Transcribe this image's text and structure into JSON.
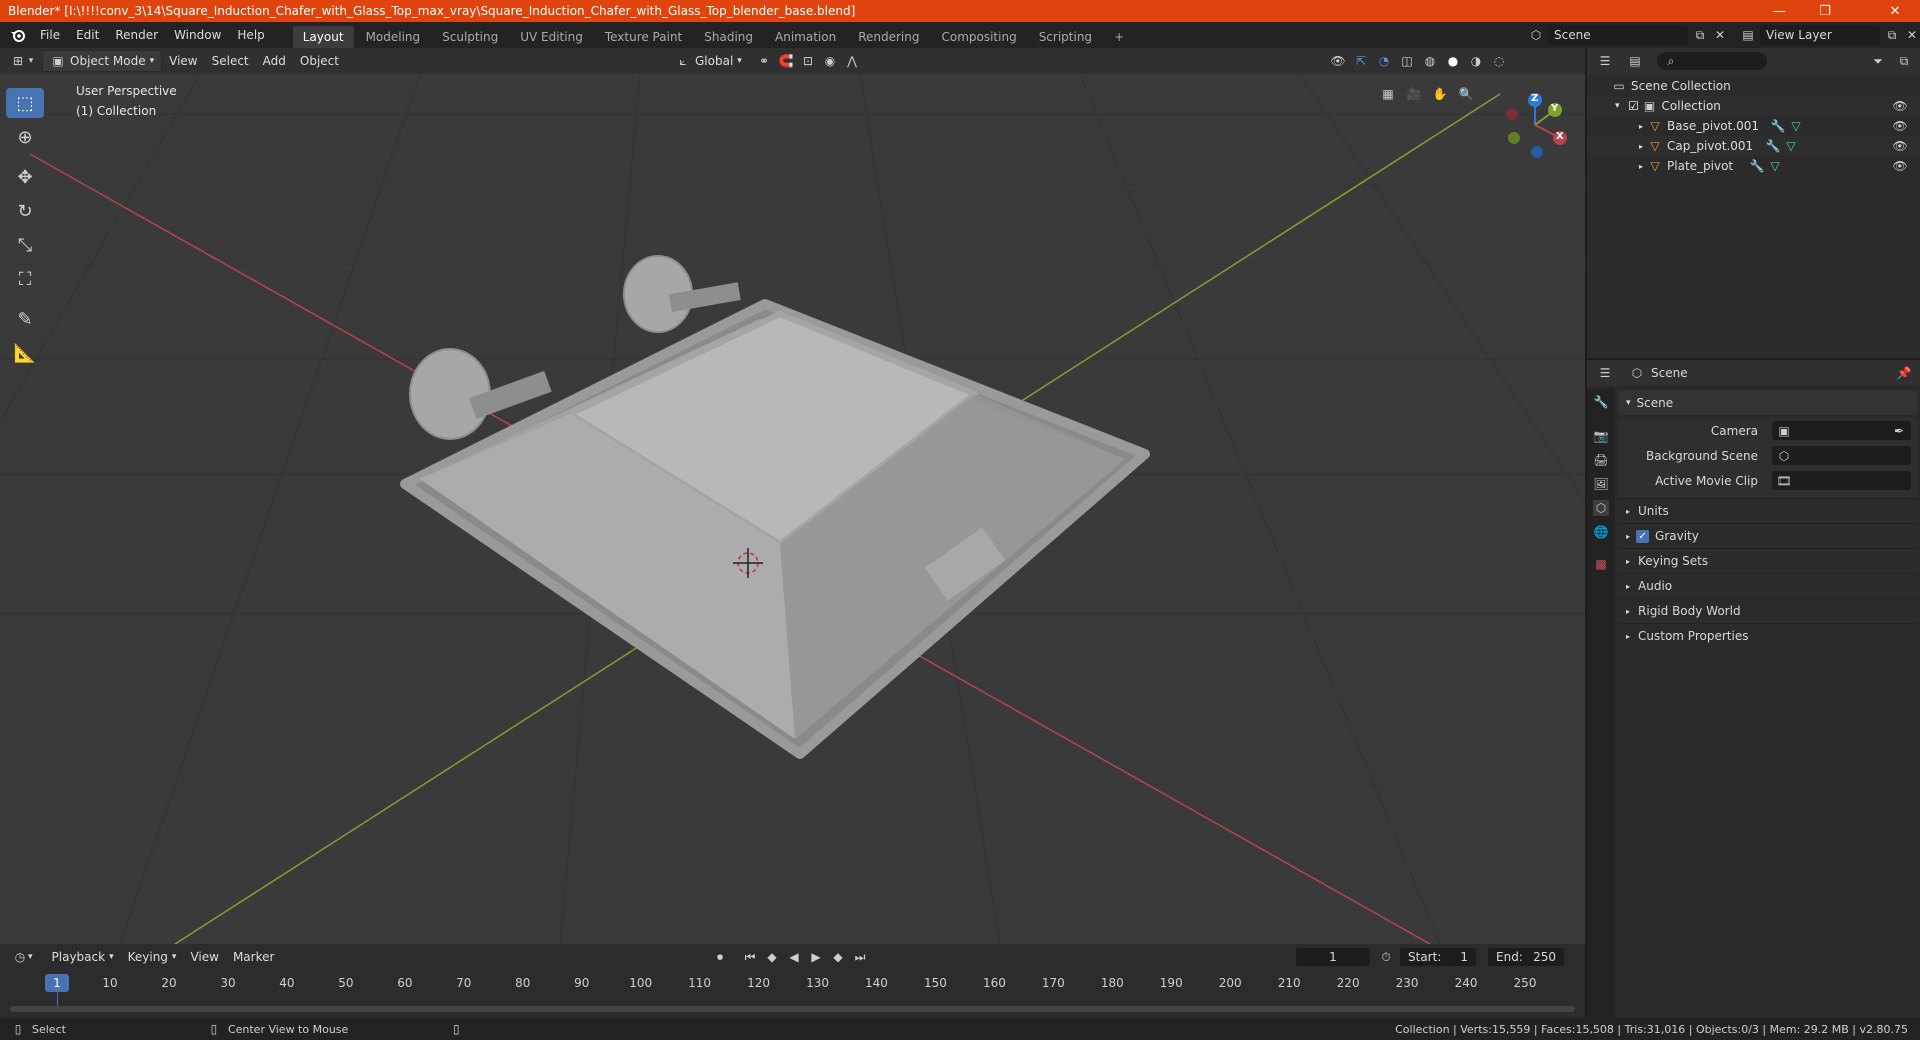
{
  "window": {
    "title": "Blender* [I:\\!!!!conv_3\\14\\Square_Induction_Chafer_with_Glass_Top_max_vray\\Square_Induction_Chafer_with_Glass_Top_blender_base.blend]",
    "minimize": "—",
    "restore": "❐",
    "close": "✕"
  },
  "menu": [
    "File",
    "Edit",
    "Render",
    "Window",
    "Help"
  ],
  "workspaces": [
    "Layout",
    "Modeling",
    "Sculpting",
    "UV Editing",
    "Texture Paint",
    "Shading",
    "Animation",
    "Rendering",
    "Compositing",
    "Scripting"
  ],
  "workspace_add": "+",
  "scene_selector": {
    "scene": "Scene",
    "view_layer": "View Layer"
  },
  "viewport_header": {
    "mode": "Object Mode",
    "menus": [
      "View",
      "Select",
      "Add",
      "Object"
    ],
    "orientation": "Global"
  },
  "viewport": {
    "overlay_line1": "User Perspective",
    "overlay_line2": "(1) Collection",
    "gizmo": {
      "z": "Z",
      "y": "Y",
      "x": "X"
    }
  },
  "outliner": {
    "root": "Scene Collection",
    "collection": "Collection",
    "objects": [
      "Base_pivot.001",
      "Cap_pivot.001",
      "Plate_pivot"
    ]
  },
  "properties": {
    "context": "Scene",
    "section": "Scene",
    "fields": [
      {
        "label": "Camera"
      },
      {
        "label": "Background Scene"
      },
      {
        "label": "Active Movie Clip"
      }
    ],
    "panels": [
      "Units",
      "Gravity",
      "Keying Sets",
      "Audio",
      "Rigid Body World",
      "Custom Properties"
    ]
  },
  "timeline": {
    "menus": [
      "Playback",
      "Keying",
      "View",
      "Marker"
    ],
    "current_frame": "1",
    "start_label": "Start:",
    "start": "1",
    "end_label": "End:",
    "end": "250",
    "ticks": [
      "1",
      "10",
      "20",
      "30",
      "40",
      "50",
      "60",
      "70",
      "80",
      "90",
      "100",
      "110",
      "120",
      "130",
      "140",
      "150",
      "160",
      "170",
      "180",
      "190",
      "200",
      "210",
      "220",
      "230",
      "240",
      "250"
    ]
  },
  "statusbar": {
    "left1": "Select",
    "left2": "Center View to Mouse",
    "right": "Collection | Verts:15,559 | Faces:15,508 | Tris:31,016 | Objects:0/3 | Mem: 29.2 MB | v2.80.75"
  },
  "colors": {
    "accent": "#4772b3",
    "titlebar": "#e0440e",
    "x_axis": "#b8434c",
    "y_axis": "#7da22e",
    "z_axis": "#2e7ad6"
  }
}
